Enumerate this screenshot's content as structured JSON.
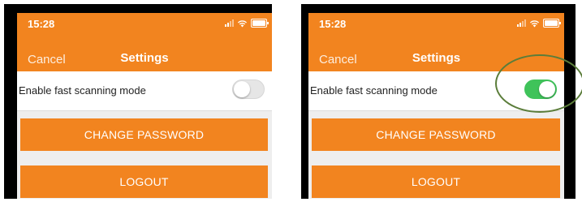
{
  "left": {
    "status_time": "15:28",
    "nav": {
      "cancel_label": "Cancel",
      "title": "Settings"
    },
    "setting": {
      "label": "Enable fast scanning mode",
      "toggle_on": false
    },
    "buttons": {
      "change_password": "CHANGE PASSWORD",
      "logout": "LOGOUT"
    }
  },
  "right": {
    "status_time": "15:28",
    "nav": {
      "cancel_label": "Cancel",
      "title": "Settings"
    },
    "setting": {
      "label": "Enable fast scanning mode",
      "toggle_on": true
    },
    "buttons": {
      "change_password": "CHANGE PASSWORD",
      "logout": "LOGOUT"
    }
  },
  "icons": [
    "signal-icon",
    "wifi-icon",
    "battery-icon"
  ],
  "colors": {
    "brand_orange": "#f2841f",
    "toggle_on": "#3fc35a",
    "toggle_off": "#e6e6e6",
    "highlight_ring": "#5b7d3a"
  }
}
